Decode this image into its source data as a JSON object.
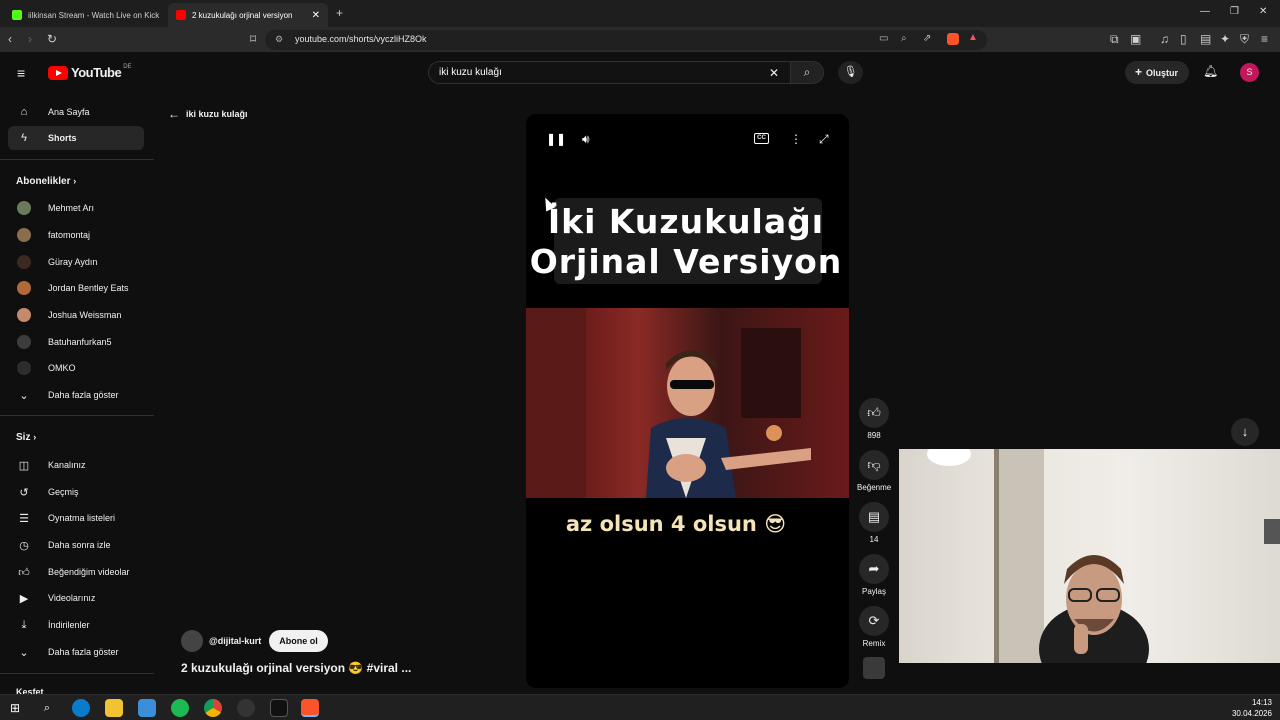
{
  "browser": {
    "tabs": [
      {
        "label": "iilkinsan Stream - Watch Live on Kick",
        "favicon": "kick-icon",
        "active": false
      },
      {
        "label": "2 kuzukulağı orjinal versiyon",
        "favicon": "youtube-icon",
        "active": true
      }
    ],
    "new_tab": "+",
    "url": "youtube.com/shorts/vyczliHZ8Ok"
  },
  "header": {
    "logo_text": "YouTube",
    "logo_country": "DE",
    "search_value": "iki kuzu kulağı",
    "create_label": "Oluştur",
    "avatar_letter": "S"
  },
  "sidebar": {
    "main": [
      {
        "label": "Ana Sayfa",
        "icon": "home-icon"
      },
      {
        "label": "Shorts",
        "icon": "shorts-icon",
        "active": true
      }
    ],
    "subs_header": "Abonelikler",
    "subs": [
      {
        "label": "Mehmet Arı",
        "color": "#6b7b5a"
      },
      {
        "label": "fatomontaj",
        "color": "#8a6f4d"
      },
      {
        "label": "Güray Aydın",
        "color": "#3a2a22"
      },
      {
        "label": "Jordan Bentley Eats",
        "color": "#b06a3a"
      },
      {
        "label": "Joshua Weissman",
        "color": "#c48a6a"
      },
      {
        "label": "Batuhanfurkan5",
        "color": "#3c3c3c"
      },
      {
        "label": "OMKO",
        "color": "#2d2d2d"
      },
      {
        "label": "Daha fazla göster",
        "icon": "chevron-down-icon"
      }
    ],
    "you_header": "Siz",
    "you": [
      {
        "label": "Kanalınız",
        "icon": "channel-icon"
      },
      {
        "label": "Geçmiş",
        "icon": "history-icon"
      },
      {
        "label": "Oynatma listeleri",
        "icon": "playlist-icon"
      },
      {
        "label": "Daha sonra izle",
        "icon": "clock-icon"
      },
      {
        "label": "Beğendiğim videolar",
        "icon": "like-icon"
      },
      {
        "label": "Videolarınız",
        "icon": "video-icon"
      },
      {
        "label": "İndirilenler",
        "icon": "download-icon"
      },
      {
        "label": "Daha fazla göster",
        "icon": "chevron-down-icon"
      }
    ],
    "explore_header": "Keşfet"
  },
  "main": {
    "back_label": "iki kuzu kulağı",
    "video": {
      "overlay_line1": "İki  Kuzukulağı",
      "overlay_line2": "Orjinal  Versiyon",
      "caption": "az olsun 4 olsun 😎"
    },
    "channel": "@dijital-kurt",
    "subscribe_label": "Abone ol",
    "title": "2 kuzukulağı orjinal versiyon 😎 #viral ..."
  },
  "actions": {
    "likes": "898",
    "dislike_label": "Beğenme",
    "comments": "14",
    "share_label": "Paylaş",
    "remix_label": "Remix"
  },
  "taskbar": {
    "time": "14:13",
    "date": "30.04.2026"
  }
}
